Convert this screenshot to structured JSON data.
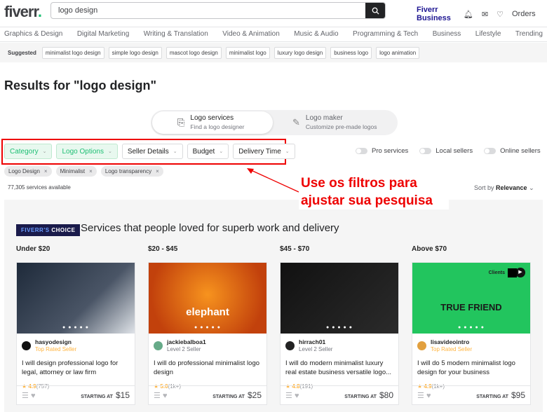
{
  "header": {
    "logo": "fiverr",
    "search_value": "logo design",
    "fiverr_business": "Fiverr Business",
    "orders": "Orders"
  },
  "categories": [
    "Graphics & Design",
    "Digital Marketing",
    "Writing & Translation",
    "Video & Animation",
    "Music & Audio",
    "Programming & Tech",
    "Business",
    "Lifestyle",
    "Trending"
  ],
  "suggested": {
    "label": "Suggested",
    "items": [
      "minimalist logo design",
      "simple logo design",
      "mascot logo design",
      "minimalist logo",
      "luxury logo design",
      "business logo",
      "logo animation"
    ]
  },
  "results_title": "Results for \"logo design\"",
  "mode_toggle": [
    {
      "title": "Logo services",
      "subtitle": "Find a logo designer"
    },
    {
      "title": "Logo maker",
      "subtitle": "Customize pre-made logos"
    }
  ],
  "filters": [
    "Category",
    "Logo Options",
    "Seller Details",
    "Budget",
    "Delivery Time"
  ],
  "switches": [
    "Pro services",
    "Local sellers",
    "Online sellers"
  ],
  "active_tags": [
    "Logo Design",
    "Minimalist",
    "Logo transparency"
  ],
  "services_count": "77,305 services available",
  "sort": {
    "label": "Sort by",
    "value": "Relevance"
  },
  "annotation": "Use os filtros para ajustar sua pesquisa",
  "section": {
    "badge_a": "FIVERR'S",
    "badge_b": "CHOICE",
    "title": "Services that people loved for superb work and delivery"
  },
  "gigs": [
    {
      "bracket": "Under $20",
      "seller": "hasyodesign",
      "level": "Top Rated Seller",
      "title": "I will design professional logo for legal, attorney or law firm",
      "rating": "4.9",
      "reviews": "(757)",
      "starting": "STARTING AT",
      "price": "$15"
    },
    {
      "bracket": "$20 - $45",
      "seller": "jackiebalboa1",
      "level": "Level 2 Seller",
      "title": "I will do professional minimalist logo design",
      "rating": "5.0",
      "reviews": "(1k+)",
      "starting": "STARTING AT",
      "price": "$25",
      "image_text": "elephant"
    },
    {
      "bracket": "$45 - $70",
      "seller": "hirrach01",
      "level": "Level 2 Seller",
      "title": "I will do modern minimalist luxury real estate business versatile logo...",
      "rating": "4.8",
      "reviews": "(191)",
      "starting": "STARTING AT",
      "price": "$80"
    },
    {
      "bracket": "Above $70",
      "seller": "lisavideointro",
      "level": "Top Rated Seller",
      "title": "I will do 5 modern minimalist logo design for your business",
      "rating": "4.9",
      "reviews": "(1k+)",
      "starting": "STARTING AT",
      "price": "$95",
      "clients": "Clients",
      "image_text": "TRUE FRIEND"
    }
  ]
}
